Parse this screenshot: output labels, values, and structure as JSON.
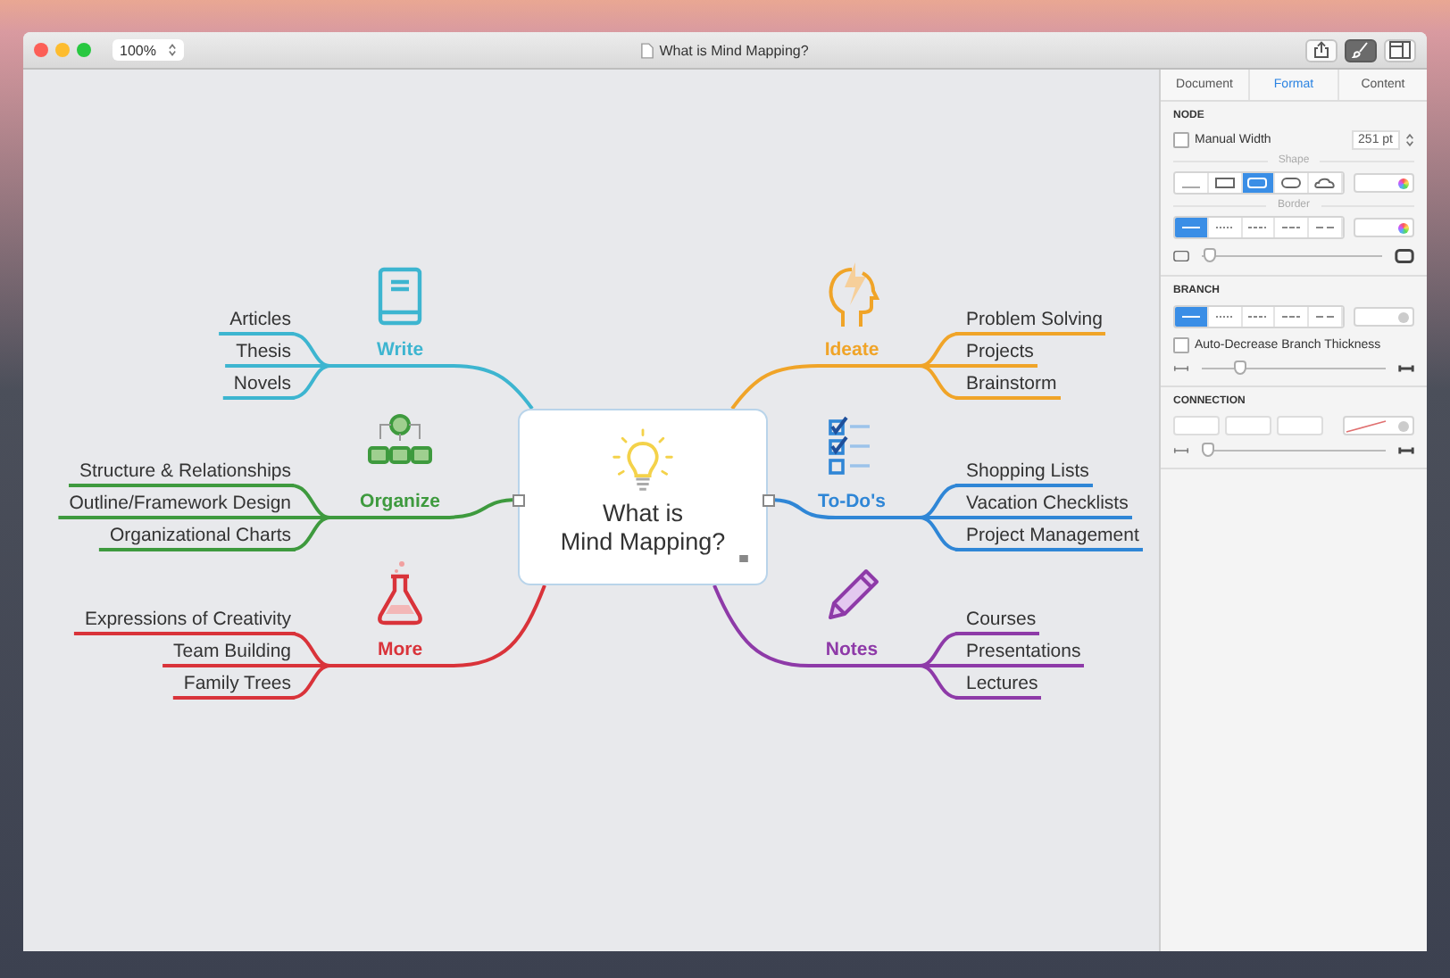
{
  "window": {
    "title": "What is Mind Mapping?",
    "zoom": "100%"
  },
  "toolbar_buttons": [
    {
      "selected": false
    },
    {
      "selected": true
    },
    {
      "selected": false
    }
  ],
  "map": {
    "central_topic": "What is\nMind Mapping?",
    "topics": [
      {
        "label": "Write",
        "color": "#3db5d0",
        "items": [
          "Articles",
          "Thesis",
          "Novels"
        ]
      },
      {
        "label": "Organize",
        "color": "#3e9a3e",
        "items": [
          "Structure & Relationships",
          "Outline/Framework Design",
          "Organizational Charts"
        ]
      },
      {
        "label": "More",
        "color": "#d9333a",
        "items": [
          "Expressions of Creativity",
          "Team Building",
          "Family Trees"
        ]
      },
      {
        "label": "Ideate",
        "color": "#f0a428",
        "items": [
          "Problem Solving",
          "Projects",
          "Brainstorm"
        ]
      },
      {
        "label": "To-Do's",
        "color": "#2f86d6",
        "items": [
          "Shopping Lists",
          "Vacation Checklists",
          "Project Management"
        ]
      },
      {
        "label": "Notes",
        "color": "#8e3aa8",
        "items": [
          "Courses",
          "Presentations",
          "Lectures"
        ]
      }
    ]
  },
  "inspector": {
    "tabs": [
      {
        "label": "Document",
        "selected": false
      },
      {
        "label": "Format",
        "selected": true
      },
      {
        "label": "Content",
        "selected": false
      }
    ],
    "node": {
      "heading": "NODE",
      "manual_width": {
        "label": "Manual Width",
        "checked": false
      },
      "width_value": "251 pt",
      "shape_label": "Shape",
      "shape_segments": [
        {
          "selected": false
        },
        {
          "selected": false
        },
        {
          "selected": true
        },
        {
          "selected": false
        },
        {
          "selected": false
        }
      ],
      "border_label": "Border",
      "border_segments": [
        {
          "selected": true
        },
        {
          "selected": false
        },
        {
          "selected": false
        },
        {
          "selected": false
        },
        {
          "selected": false
        }
      ],
      "border_slider": {
        "level": 0.04
      }
    },
    "branch": {
      "heading": "BRANCH",
      "style_segments": [
        {
          "selected": true
        },
        {
          "selected": false
        },
        {
          "selected": false
        },
        {
          "selected": false
        },
        {
          "selected": false
        }
      ],
      "auto_decrease": {
        "label": "Auto-Decrease Branch Thickness",
        "checked": false
      },
      "thickness_slider": {
        "level": 0.2
      }
    },
    "connection": {
      "heading": "CONNECTION",
      "slider": {
        "level": 0.03
      }
    }
  }
}
